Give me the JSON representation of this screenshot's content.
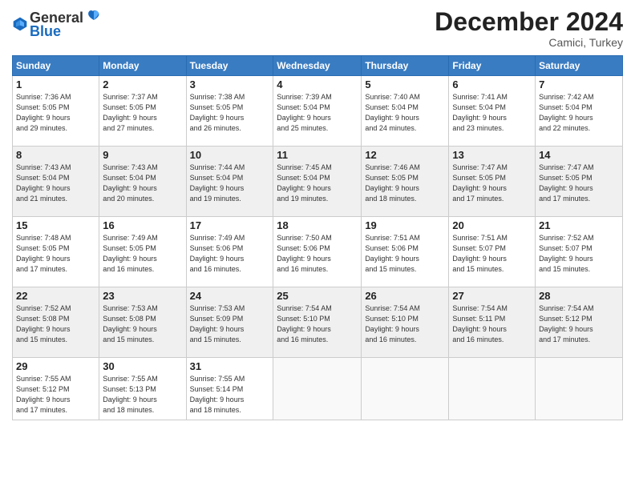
{
  "header": {
    "logo_general": "General",
    "logo_blue": "Blue",
    "month": "December 2024",
    "location": "Camici, Turkey"
  },
  "weekdays": [
    "Sunday",
    "Monday",
    "Tuesday",
    "Wednesday",
    "Thursday",
    "Friday",
    "Saturday"
  ],
  "weeks": [
    [
      {
        "day": "1",
        "lines": [
          "Sunrise: 7:36 AM",
          "Sunset: 5:05 PM",
          "Daylight: 9 hours",
          "and 29 minutes."
        ]
      },
      {
        "day": "2",
        "lines": [
          "Sunrise: 7:37 AM",
          "Sunset: 5:05 PM",
          "Daylight: 9 hours",
          "and 27 minutes."
        ]
      },
      {
        "day": "3",
        "lines": [
          "Sunrise: 7:38 AM",
          "Sunset: 5:05 PM",
          "Daylight: 9 hours",
          "and 26 minutes."
        ]
      },
      {
        "day": "4",
        "lines": [
          "Sunrise: 7:39 AM",
          "Sunset: 5:04 PM",
          "Daylight: 9 hours",
          "and 25 minutes."
        ]
      },
      {
        "day": "5",
        "lines": [
          "Sunrise: 7:40 AM",
          "Sunset: 5:04 PM",
          "Daylight: 9 hours",
          "and 24 minutes."
        ]
      },
      {
        "day": "6",
        "lines": [
          "Sunrise: 7:41 AM",
          "Sunset: 5:04 PM",
          "Daylight: 9 hours",
          "and 23 minutes."
        ]
      },
      {
        "day": "7",
        "lines": [
          "Sunrise: 7:42 AM",
          "Sunset: 5:04 PM",
          "Daylight: 9 hours",
          "and 22 minutes."
        ]
      }
    ],
    [
      {
        "day": "8",
        "lines": [
          "Sunrise: 7:43 AM",
          "Sunset: 5:04 PM",
          "Daylight: 9 hours",
          "and 21 minutes."
        ]
      },
      {
        "day": "9",
        "lines": [
          "Sunrise: 7:43 AM",
          "Sunset: 5:04 PM",
          "Daylight: 9 hours",
          "and 20 minutes."
        ]
      },
      {
        "day": "10",
        "lines": [
          "Sunrise: 7:44 AM",
          "Sunset: 5:04 PM",
          "Daylight: 9 hours",
          "and 19 minutes."
        ]
      },
      {
        "day": "11",
        "lines": [
          "Sunrise: 7:45 AM",
          "Sunset: 5:04 PM",
          "Daylight: 9 hours",
          "and 19 minutes."
        ]
      },
      {
        "day": "12",
        "lines": [
          "Sunrise: 7:46 AM",
          "Sunset: 5:05 PM",
          "Daylight: 9 hours",
          "and 18 minutes."
        ]
      },
      {
        "day": "13",
        "lines": [
          "Sunrise: 7:47 AM",
          "Sunset: 5:05 PM",
          "Daylight: 9 hours",
          "and 17 minutes."
        ]
      },
      {
        "day": "14",
        "lines": [
          "Sunrise: 7:47 AM",
          "Sunset: 5:05 PM",
          "Daylight: 9 hours",
          "and 17 minutes."
        ]
      }
    ],
    [
      {
        "day": "15",
        "lines": [
          "Sunrise: 7:48 AM",
          "Sunset: 5:05 PM",
          "Daylight: 9 hours",
          "and 17 minutes."
        ]
      },
      {
        "day": "16",
        "lines": [
          "Sunrise: 7:49 AM",
          "Sunset: 5:05 PM",
          "Daylight: 9 hours",
          "and 16 minutes."
        ]
      },
      {
        "day": "17",
        "lines": [
          "Sunrise: 7:49 AM",
          "Sunset: 5:06 PM",
          "Daylight: 9 hours",
          "and 16 minutes."
        ]
      },
      {
        "day": "18",
        "lines": [
          "Sunrise: 7:50 AM",
          "Sunset: 5:06 PM",
          "Daylight: 9 hours",
          "and 16 minutes."
        ]
      },
      {
        "day": "19",
        "lines": [
          "Sunrise: 7:51 AM",
          "Sunset: 5:06 PM",
          "Daylight: 9 hours",
          "and 15 minutes."
        ]
      },
      {
        "day": "20",
        "lines": [
          "Sunrise: 7:51 AM",
          "Sunset: 5:07 PM",
          "Daylight: 9 hours",
          "and 15 minutes."
        ]
      },
      {
        "day": "21",
        "lines": [
          "Sunrise: 7:52 AM",
          "Sunset: 5:07 PM",
          "Daylight: 9 hours",
          "and 15 minutes."
        ]
      }
    ],
    [
      {
        "day": "22",
        "lines": [
          "Sunrise: 7:52 AM",
          "Sunset: 5:08 PM",
          "Daylight: 9 hours",
          "and 15 minutes."
        ]
      },
      {
        "day": "23",
        "lines": [
          "Sunrise: 7:53 AM",
          "Sunset: 5:08 PM",
          "Daylight: 9 hours",
          "and 15 minutes."
        ]
      },
      {
        "day": "24",
        "lines": [
          "Sunrise: 7:53 AM",
          "Sunset: 5:09 PM",
          "Daylight: 9 hours",
          "and 15 minutes."
        ]
      },
      {
        "day": "25",
        "lines": [
          "Sunrise: 7:54 AM",
          "Sunset: 5:10 PM",
          "Daylight: 9 hours",
          "and 16 minutes."
        ]
      },
      {
        "day": "26",
        "lines": [
          "Sunrise: 7:54 AM",
          "Sunset: 5:10 PM",
          "Daylight: 9 hours",
          "and 16 minutes."
        ]
      },
      {
        "day": "27",
        "lines": [
          "Sunrise: 7:54 AM",
          "Sunset: 5:11 PM",
          "Daylight: 9 hours",
          "and 16 minutes."
        ]
      },
      {
        "day": "28",
        "lines": [
          "Sunrise: 7:54 AM",
          "Sunset: 5:12 PM",
          "Daylight: 9 hours",
          "and 17 minutes."
        ]
      }
    ],
    [
      {
        "day": "29",
        "lines": [
          "Sunrise: 7:55 AM",
          "Sunset: 5:12 PM",
          "Daylight: 9 hours",
          "and 17 minutes."
        ]
      },
      {
        "day": "30",
        "lines": [
          "Sunrise: 7:55 AM",
          "Sunset: 5:13 PM",
          "Daylight: 9 hours",
          "and 18 minutes."
        ]
      },
      {
        "day": "31",
        "lines": [
          "Sunrise: 7:55 AM",
          "Sunset: 5:14 PM",
          "Daylight: 9 hours",
          "and 18 minutes."
        ]
      },
      null,
      null,
      null,
      null
    ]
  ]
}
